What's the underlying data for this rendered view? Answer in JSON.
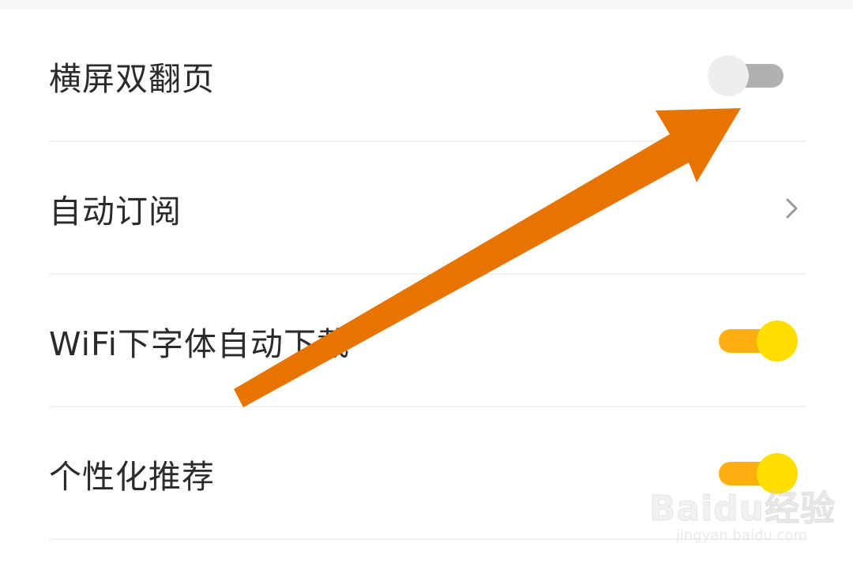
{
  "settings": {
    "items": [
      {
        "label": "横屏双翻页",
        "control": "switch",
        "state": "off"
      },
      {
        "label": "自动订阅",
        "control": "chevron"
      },
      {
        "label": "WiFi下字体自动下载",
        "control": "switch",
        "state": "on"
      },
      {
        "label": "个性化推荐",
        "control": "switch",
        "state": "on"
      }
    ]
  },
  "colors": {
    "switch_on_track": "#ffae10",
    "switch_on_thumb": "#ffdf00",
    "switch_off_track": "#b0b0b0",
    "switch_off_thumb": "#eeeeee",
    "annotation_arrow": "#e87400"
  },
  "icons": {
    "chevron": "chevron-right-icon"
  },
  "watermark": {
    "logo_text": "Baidu经验",
    "url": "jingyan.baidu.com"
  }
}
